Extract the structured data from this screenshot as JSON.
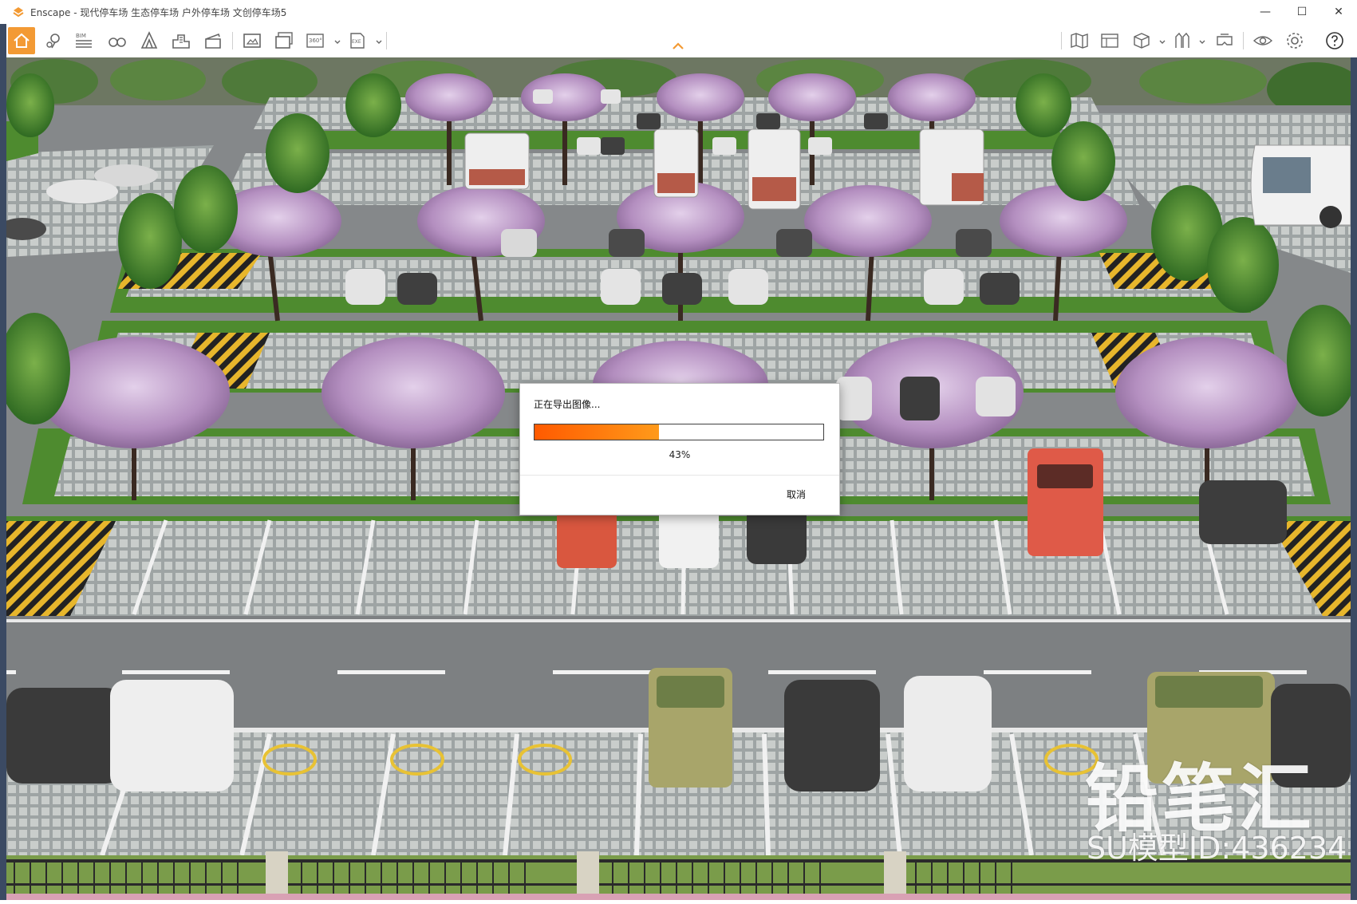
{
  "window": {
    "app_name": "Enscape",
    "title": "Enscape - 现代停车场 生态停车场 户外停车场 文创停车场5",
    "accent_color": "#f39a34",
    "controls": [
      {
        "name": "minimize",
        "glyph": "—"
      },
      {
        "name": "maximize",
        "glyph": "☐"
      },
      {
        "name": "close",
        "glyph": "✕"
      }
    ]
  },
  "toolbar": {
    "bim_label": "BIM",
    "pano_label": "360°",
    "exe_label": "EXE",
    "left_icons": [
      "home-icon",
      "location-pin-icon",
      "bim-icon",
      "binoculars-icon",
      "building-outline-icon",
      "city-icon",
      "clapperboard-icon",
      "screenshot-icon",
      "batch-render-icon",
      "panorama-360-icon",
      "exe-export-icon"
    ],
    "right_icons": [
      "map-icon",
      "bim-table-icon",
      "cube-view-icon",
      "asset-library-icon",
      "vr-headset-icon",
      "eye-icon",
      "gear-icon",
      "help-icon"
    ]
  },
  "viewport": {
    "description_colors": {
      "road": "#8a8d8f",
      "grass": "#4a8a2e",
      "paver": "#b7bcbd",
      "sky": "#6f7a62",
      "blossom": "#b89bc5"
    }
  },
  "watermark": {
    "brand": "铅笔汇",
    "model_id": "SU模型ID:436234"
  },
  "dialog": {
    "title": "正在导出图像...",
    "progress": 43,
    "progress_text": "43%",
    "cancel_label": "取消"
  }
}
